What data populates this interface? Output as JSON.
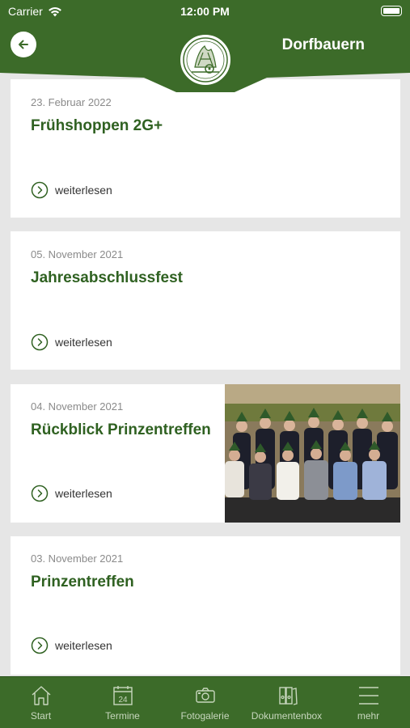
{
  "status_bar": {
    "carrier": "Carrier",
    "time": "12:00 PM"
  },
  "header": {
    "title": "Dorfbauern",
    "back_icon": "arrow-left-icon",
    "logo": "club-logo"
  },
  "colors": {
    "brand_green": "#3c6b29",
    "title_green": "#2f6121",
    "background": "#e6e6e6"
  },
  "posts": [
    {
      "date": "23. Februar 2022",
      "title": "Frühshoppen 2G+",
      "read_more": "weiterlesen",
      "has_image": false
    },
    {
      "date": "05. November 2021",
      "title": "Jahresabschlussfest",
      "read_more": "weiterlesen",
      "has_image": false
    },
    {
      "date": "04. November 2021",
      "title": "Rückblick Prinzentreffen",
      "read_more": "weiterlesen",
      "has_image": true
    },
    {
      "date": "03. November 2021",
      "title": "Prinzentreffen",
      "read_more": "weiterlesen",
      "has_image": false
    }
  ],
  "tabbar": [
    {
      "label": "Start",
      "icon": "home-icon"
    },
    {
      "label": "Termine",
      "icon": "calendar-icon",
      "calendar_day": "24"
    },
    {
      "label": "Fotogalerie",
      "icon": "camera-icon"
    },
    {
      "label": "Dokumentenbox",
      "icon": "binders-icon"
    },
    {
      "label": "mehr",
      "icon": "menu-icon"
    }
  ]
}
